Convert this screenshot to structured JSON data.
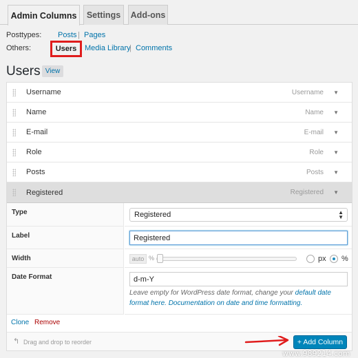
{
  "tabs": [
    {
      "label": "Admin Columns",
      "active": true
    },
    {
      "label": "Settings",
      "active": false
    },
    {
      "label": "Add-ons",
      "active": false
    }
  ],
  "subnav": {
    "posttypes_label": "Posttypes:",
    "posttypes": [
      "Posts",
      "Pages"
    ],
    "others_label": "Others:",
    "others": [
      "Users",
      "Media Library",
      "Comments"
    ],
    "current": "Users",
    "separator": "|"
  },
  "heading": {
    "title": "Users",
    "view_label": "View"
  },
  "columns": [
    {
      "label": "Username",
      "type": "Username"
    },
    {
      "label": "Name",
      "type": "Name"
    },
    {
      "label": "E-mail",
      "type": "E-mail"
    },
    {
      "label": "Role",
      "type": "Role"
    },
    {
      "label": "Posts",
      "type": "Posts"
    },
    {
      "label": "Registered",
      "type": "Registered",
      "expanded": true
    }
  ],
  "settings": {
    "type_label": "Type",
    "type_value": "Registered",
    "label_label": "Label",
    "label_value": "Registered",
    "width_label": "Width",
    "width_auto": "auto",
    "width_pct_mark": "%",
    "width_units": [
      "px",
      "%"
    ],
    "width_selected_unit": "%",
    "date_format_label": "Date Format",
    "date_format_value": "d-m-Y",
    "hint_text": "Leave empty for WordPress date format, change your",
    "hint_link1": "default date format here.",
    "hint_link2": "Documentation on date and time formatting."
  },
  "actions": {
    "clone": "Clone",
    "remove": "Remove"
  },
  "footer": {
    "drag_hint": "Drag and drop to reorder",
    "add_button": "+ Add Column"
  },
  "watermark": "www.989214.com",
  "colors": {
    "accent": "#0085ba",
    "link": "#0073aa",
    "highlight": "#e01c1c",
    "remove": "#aa0000"
  }
}
